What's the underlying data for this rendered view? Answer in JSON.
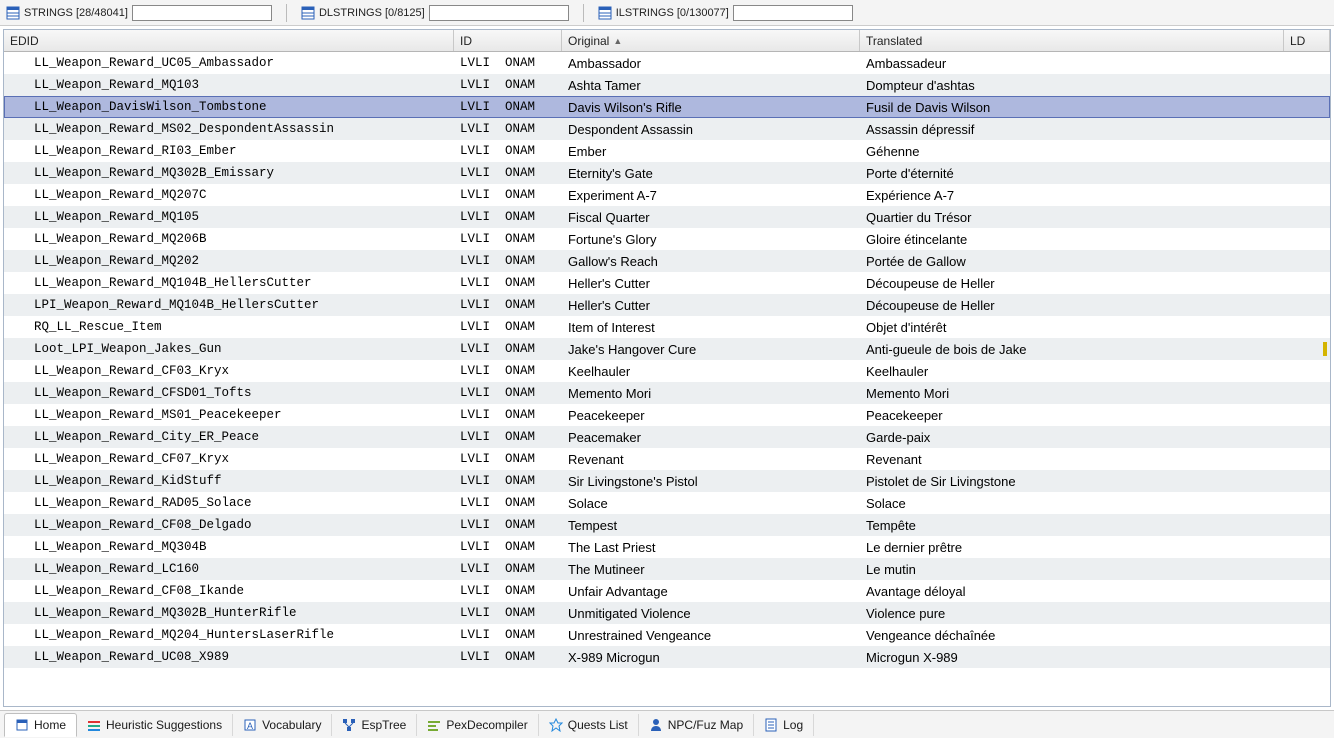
{
  "top_tabs": {
    "strings": {
      "label": "STRINGS [28/48041]"
    },
    "dlstrings": {
      "label": "DLSTRINGS [0/8125]"
    },
    "ilstrings": {
      "label": "ILSTRINGS [0/130077]"
    }
  },
  "columns": {
    "edid": "EDID",
    "id": "ID",
    "original": "Original",
    "translated": "Translated",
    "ld": "LD"
  },
  "selected_index": 2,
  "rows": [
    {
      "edid": "LL_Weapon_Reward_UC05_Ambassador",
      "id": "LVLI  ONAM",
      "original": "Ambassador",
      "translated": "Ambassadeur"
    },
    {
      "edid": "LL_Weapon_Reward_MQ103",
      "id": "LVLI  ONAM",
      "original": "Ashta Tamer",
      "translated": "Dompteur d'ashtas"
    },
    {
      "edid": "LL_Weapon_DavisWilson_Tombstone",
      "id": "LVLI  ONAM",
      "original": "Davis Wilson's Rifle",
      "translated": "Fusil de Davis Wilson"
    },
    {
      "edid": "LL_Weapon_Reward_MS02_DespondentAssassin",
      "id": "LVLI  ONAM",
      "original": "Despondent Assassin",
      "translated": "Assassin dépressif"
    },
    {
      "edid": "LL_Weapon_Reward_RI03_Ember",
      "id": "LVLI  ONAM",
      "original": "Ember",
      "translated": "Géhenne"
    },
    {
      "edid": "LL_Weapon_Reward_MQ302B_Emissary",
      "id": "LVLI  ONAM",
      "original": "Eternity's Gate",
      "translated": "Porte d'éternité"
    },
    {
      "edid": "LL_Weapon_Reward_MQ207C",
      "id": "LVLI  ONAM",
      "original": "Experiment A-7",
      "translated": "Expérience A-7"
    },
    {
      "edid": "LL_Weapon_Reward_MQ105",
      "id": "LVLI  ONAM",
      "original": "Fiscal Quarter",
      "translated": "Quartier du Trésor"
    },
    {
      "edid": "LL_Weapon_Reward_MQ206B",
      "id": "LVLI  ONAM",
      "original": "Fortune's Glory",
      "translated": "Gloire étincelante"
    },
    {
      "edid": "LL_Weapon_Reward_MQ202",
      "id": "LVLI  ONAM",
      "original": "Gallow's Reach",
      "translated": "Portée de Gallow"
    },
    {
      "edid": "LL_Weapon_Reward_MQ104B_HellersCutter",
      "id": "LVLI  ONAM",
      "original": "Heller's Cutter",
      "translated": "Découpeuse de Heller"
    },
    {
      "edid": "LPI_Weapon_Reward_MQ104B_HellersCutter",
      "id": "LVLI  ONAM",
      "original": "Heller's Cutter",
      "translated": "Découpeuse de Heller"
    },
    {
      "edid": "RQ_LL_Rescue_Item",
      "id": "LVLI  ONAM",
      "original": "Item of Interest",
      "translated": "Objet d'intérêt"
    },
    {
      "edid": "Loot_LPI_Weapon_Jakes_Gun",
      "id": "LVLI  ONAM",
      "original": "Jake's Hangover Cure",
      "translated": "Anti-gueule de bois de Jake",
      "ld": true
    },
    {
      "edid": "LL_Weapon_Reward_CF03_Kryx",
      "id": "LVLI  ONAM",
      "original": "Keelhauler",
      "translated": "Keelhauler"
    },
    {
      "edid": "LL_Weapon_Reward_CFSD01_Tofts",
      "id": "LVLI  ONAM",
      "original": "Memento Mori",
      "translated": "Memento Mori"
    },
    {
      "edid": "LL_Weapon_Reward_MS01_Peacekeeper",
      "id": "LVLI  ONAM",
      "original": "Peacekeeper",
      "translated": "Peacekeeper"
    },
    {
      "edid": "LL_Weapon_Reward_City_ER_Peace",
      "id": "LVLI  ONAM",
      "original": "Peacemaker",
      "translated": "Garde-paix"
    },
    {
      "edid": "LL_Weapon_Reward_CF07_Kryx",
      "id": "LVLI  ONAM",
      "original": "Revenant",
      "translated": "Revenant"
    },
    {
      "edid": "LL_Weapon_Reward_KidStuff",
      "id": "LVLI  ONAM",
      "original": "Sir Livingstone's Pistol",
      "translated": "Pistolet de Sir Livingstone"
    },
    {
      "edid": "LL_Weapon_Reward_RAD05_Solace",
      "id": "LVLI  ONAM",
      "original": "Solace",
      "translated": "Solace"
    },
    {
      "edid": "LL_Weapon_Reward_CF08_Delgado",
      "id": "LVLI  ONAM",
      "original": "Tempest",
      "translated": "Tempête"
    },
    {
      "edid": "LL_Weapon_Reward_MQ304B",
      "id": "LVLI  ONAM",
      "original": "The Last Priest",
      "translated": "Le dernier prêtre"
    },
    {
      "edid": "LL_Weapon_Reward_LC160",
      "id": "LVLI  ONAM",
      "original": "The Mutineer",
      "translated": "Le mutin"
    },
    {
      "edid": "LL_Weapon_Reward_CF08_Ikande",
      "id": "LVLI  ONAM",
      "original": "Unfair Advantage",
      "translated": "Avantage déloyal"
    },
    {
      "edid": "LL_Weapon_Reward_MQ302B_HunterRifle",
      "id": "LVLI  ONAM",
      "original": "Unmitigated Violence",
      "translated": "Violence pure"
    },
    {
      "edid": "LL_Weapon_Reward_MQ204_HuntersLaserRifle",
      "id": "LVLI  ONAM",
      "original": "Unrestrained Vengeance",
      "translated": "Vengeance déchaînée"
    },
    {
      "edid": "LL_Weapon_Reward_UC08_X989",
      "id": "LVLI  ONAM",
      "original": "X-989 Microgun",
      "translated": "Microgun X-989"
    }
  ],
  "bottom_tabs": [
    {
      "label": "Home",
      "icon": "home",
      "active": true
    },
    {
      "label": "Heuristic Suggestions",
      "icon": "heuristic"
    },
    {
      "label": "Vocabulary",
      "icon": "vocab"
    },
    {
      "label": "EspTree",
      "icon": "tree"
    },
    {
      "label": "PexDecompiler",
      "icon": "pex"
    },
    {
      "label": "Quests List",
      "icon": "quest"
    },
    {
      "label": "NPC/Fuz Map",
      "icon": "npc"
    },
    {
      "label": "Log",
      "icon": "log"
    }
  ]
}
